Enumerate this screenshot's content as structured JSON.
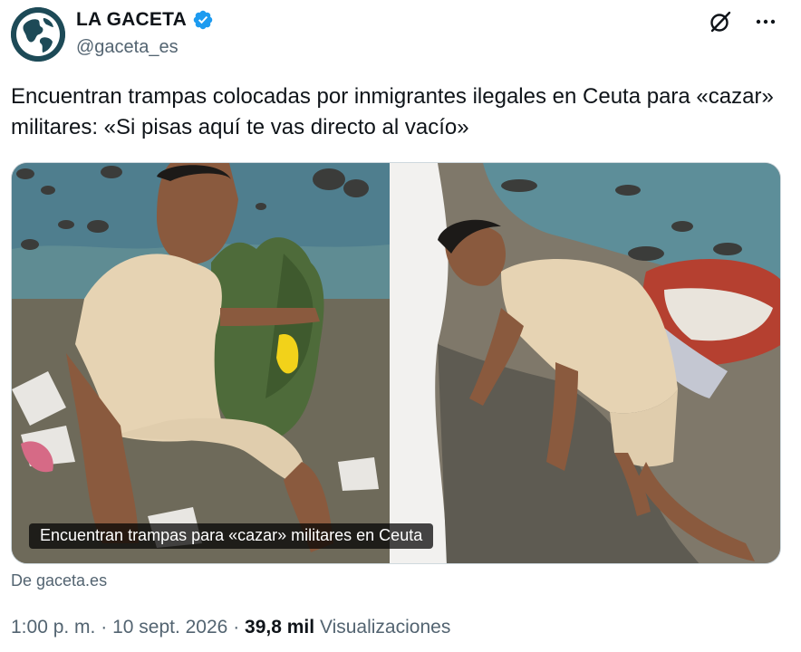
{
  "author": {
    "display_name": "LA GACETA",
    "handle": "@gaceta_es",
    "verified": true,
    "avatar_icon": "globe-icon"
  },
  "tweet": {
    "text": "Encuentran trampas colocadas por inmigrantes ilegales en Ceuta para «cazar» militares: «Si pisas aquí te vas directo al vacío»"
  },
  "media": {
    "caption": "Encuentran trampas para «cazar» militares en Ceuta"
  },
  "source": {
    "text": "De gaceta.es"
  },
  "meta": {
    "time": "1:00 p. m.",
    "separator": "·",
    "date": "10 sept. 2026",
    "views_count": "39,8 mil",
    "views_label": "Visualizaciones"
  },
  "colors": {
    "accent": "#1d9bf0",
    "text": "#0f1419",
    "secondary": "#536471"
  },
  "icons": {
    "grok": "grok-icon",
    "more": "more-icon",
    "verified": "verified-badge-icon"
  }
}
